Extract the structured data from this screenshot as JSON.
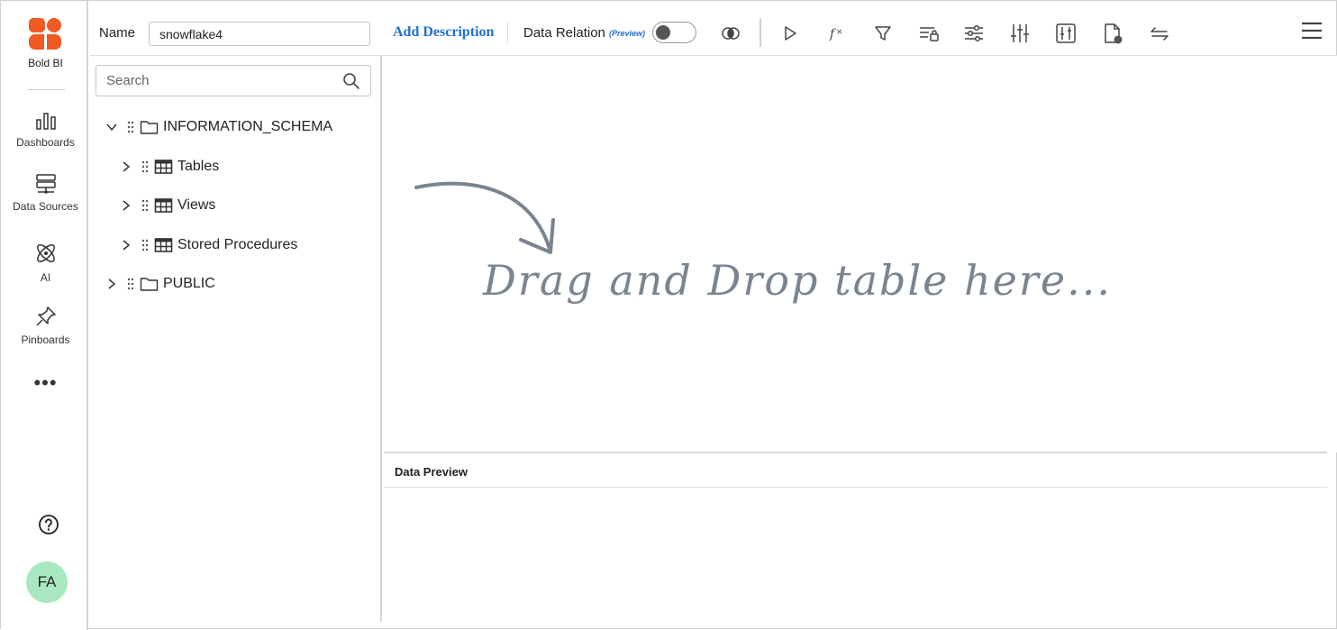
{
  "app": {
    "brand": "Bold BI"
  },
  "nav": {
    "items": [
      {
        "label": "Dashboards",
        "icon": "bar-chart-icon"
      },
      {
        "label": "Data Sources",
        "icon": "database-icon"
      },
      {
        "label": "AI",
        "icon": "atom-icon"
      },
      {
        "label": "Pinboards",
        "icon": "pin-icon"
      }
    ],
    "more": "•••",
    "user_initials": "FA"
  },
  "toolbar": {
    "name_label": "Name",
    "name_value": "snowflake4",
    "add_description": "Add Description",
    "data_relation_label": "Data Relation",
    "data_relation_badge": "(Preview)"
  },
  "tree": {
    "search_placeholder": "Search",
    "nodes": [
      {
        "label": "INFORMATION_SCHEMA",
        "expanded": true
      },
      {
        "label": "Tables"
      },
      {
        "label": "Views"
      },
      {
        "label": "Stored Procedures"
      },
      {
        "label": "PUBLIC",
        "expanded": false
      }
    ]
  },
  "canvas": {
    "drop_hint": "Drag and Drop table here..."
  },
  "preview": {
    "title": "Data Preview"
  },
  "colors": {
    "accent": "#1f6fd1",
    "brand": "#f15a22",
    "avatar": "#a9e7c1"
  }
}
